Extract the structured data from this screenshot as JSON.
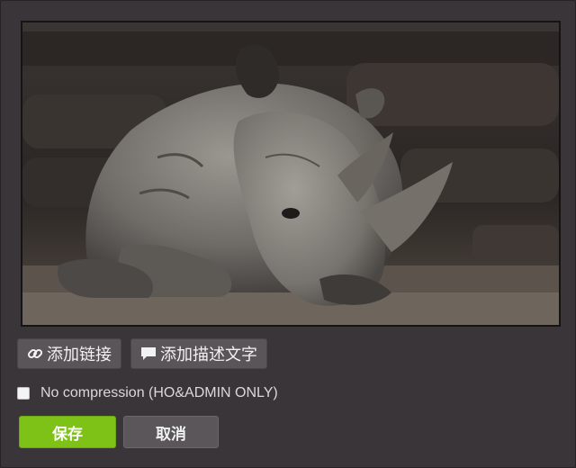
{
  "image": {
    "subject": "rhinoceros-photo"
  },
  "toolbar": {
    "add_link_label": "添加链接",
    "add_link_icon": "link-icon",
    "add_caption_label": "添加描述文字",
    "add_caption_icon": "comment-icon"
  },
  "options": {
    "no_compression_label": "No compression (HO&ADMIN ONLY)",
    "no_compression_checked": false
  },
  "actions": {
    "save_label": "保存",
    "cancel_label": "取消"
  },
  "colors": {
    "save_green": "#7fc217",
    "panel_bg": "#3a3539",
    "button_gray": "#595559"
  }
}
